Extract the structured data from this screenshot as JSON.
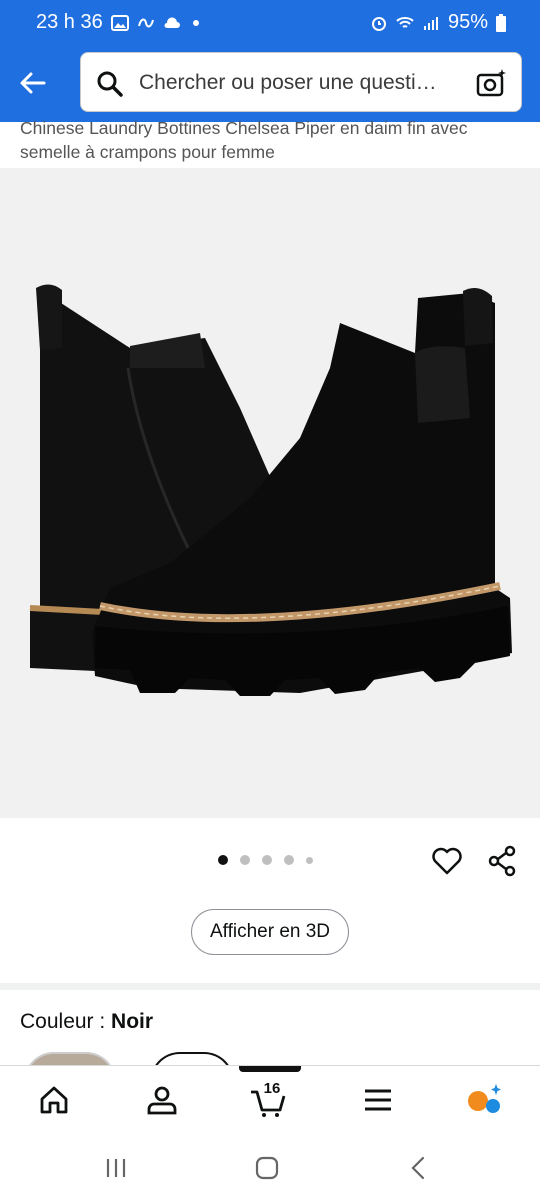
{
  "status": {
    "time": "23 h 36",
    "battery": "95%",
    "icons_left": [
      "gallery-icon",
      "signal-link-icon",
      "cloud-icon",
      "dot-icon"
    ],
    "icons_right": [
      "alarm-icon",
      "wifi-icon",
      "signal-icon",
      "battery-icon"
    ]
  },
  "header": {
    "search_placeholder": "Chercher ou poser une questi…"
  },
  "product": {
    "title": "Chinese Laundry Bottines Chelsea Piper en daim fin avec semelle à crampons pour femme",
    "image_alt": "black suede chelsea boots",
    "image_count": 5,
    "active_image": 1
  },
  "actions": {
    "view_3d_label": "Afficher en 3D"
  },
  "variation": {
    "label": "Couleur : ",
    "value": "Noir"
  },
  "bottom_nav": {
    "cart_count": "16",
    "items": [
      "home-icon",
      "account-icon",
      "cart-icon",
      "menu-icon",
      "rufus-icon"
    ]
  },
  "colors": {
    "brand_blue": "#1f6fe0",
    "rufus_orange": "#f28b1e",
    "rufus_blue": "#1d8ce0"
  }
}
